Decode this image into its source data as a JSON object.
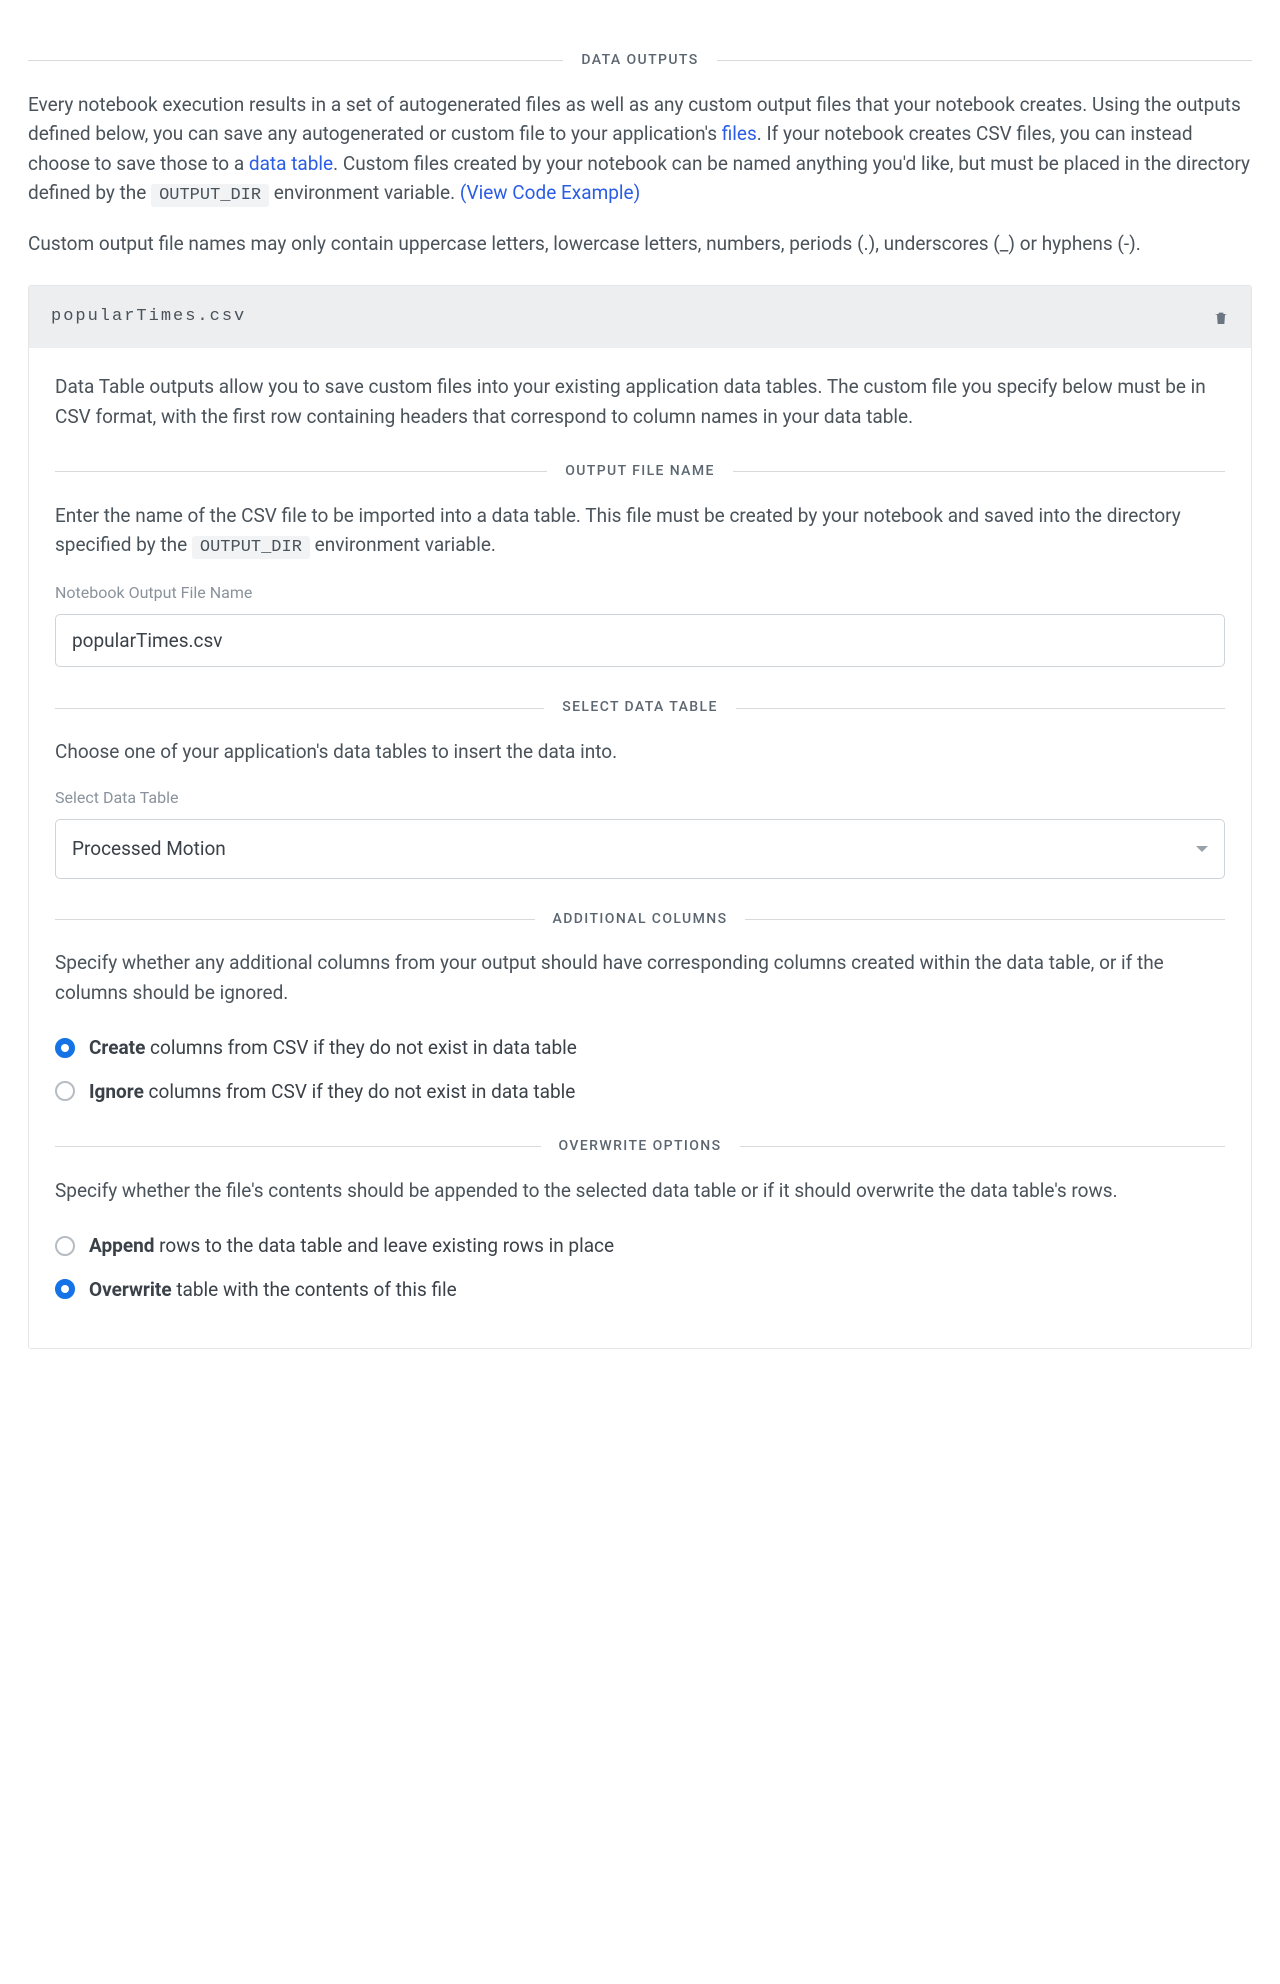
{
  "sections": {
    "data_outputs": "DATA OUTPUTS",
    "output_file_name": "OUTPUT FILE NAME",
    "select_data_table": "SELECT DATA TABLE",
    "additional_columns": "ADDITIONAL COLUMNS",
    "overwrite_options": "OVERWRITE OPTIONS"
  },
  "intro": {
    "part1": "Every notebook execution results in a set of autogenerated files as well as any custom output files that your notebook creates. Using the outputs defined below, you can save any autogenerated or custom file to your application's ",
    "link_files": "files",
    "part2": ". If your notebook creates CSV files, you can instead choose to save those to a ",
    "link_data_table": "data table",
    "part3": ". Custom files created by your notebook can be named anything you'd like, but must be placed in the directory defined by the ",
    "env_var": "OUTPUT_DIR",
    "part4": " environment variable. ",
    "link_example": "(View Code Example)",
    "para2": "Custom output file names may only contain uppercase letters, lowercase letters, numbers, periods (.), underscores (_) or hyphens (-)."
  },
  "panel": {
    "filename": "popularTimes.csv",
    "desc": "Data Table outputs allow you to save custom files into your existing application data tables. The custom file you specify below must be in CSV format, with the first row containing headers that correspond to column names in your data table.",
    "output_file": {
      "desc_a": "Enter the name of the CSV file to be imported into a data table. This file must be created by your notebook and saved into the directory specified by the ",
      "env_var": "OUTPUT_DIR",
      "desc_b": " environment variable.",
      "label": "Notebook Output File Name",
      "value": "popularTimes.csv"
    },
    "select_table": {
      "desc": "Choose one of your application's data tables to insert the data into.",
      "label": "Select Data Table",
      "value": "Processed Motion"
    },
    "additional_columns": {
      "desc": "Specify whether any additional columns from your output should have corresponding columns created within the data table, or if the columns should be ignored.",
      "opt_create_strong": "Create",
      "opt_create_rest": " columns from CSV if they do not exist in data table",
      "opt_ignore_strong": "Ignore",
      "opt_ignore_rest": " columns from CSV if they do not exist in data table",
      "selected": "create"
    },
    "overwrite": {
      "desc": "Specify whether the file's contents should be appended to the selected data table or if it should overwrite the data table's rows.",
      "opt_append_strong": "Append",
      "opt_append_rest": " rows to the data table and leave existing rows in place",
      "opt_overwrite_strong": "Overwrite",
      "opt_overwrite_rest": " table with the contents of this file",
      "selected": "overwrite"
    }
  }
}
